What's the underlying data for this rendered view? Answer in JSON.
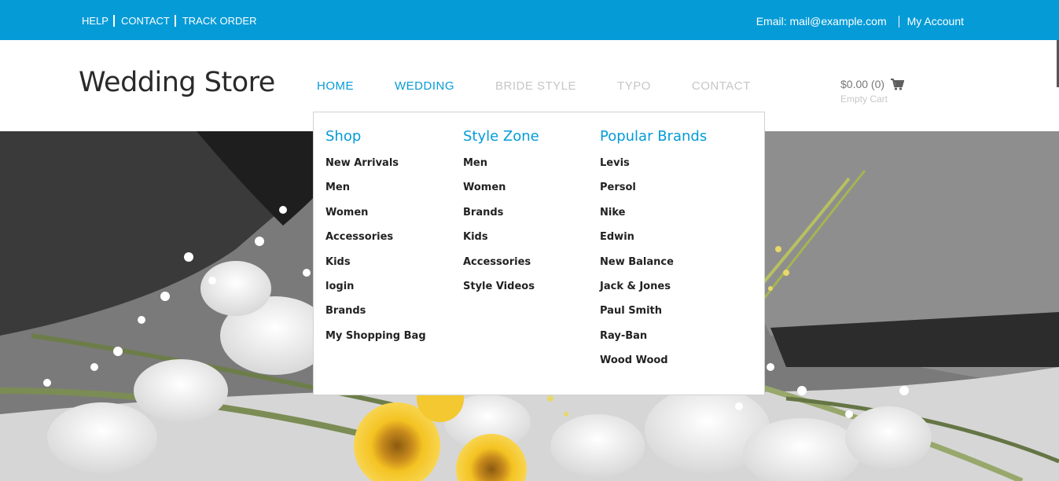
{
  "topbar": {
    "links": [
      "HELP",
      "CONTACT",
      "TRACK ORDER"
    ],
    "email": "Email: mail@example.com",
    "account": "My Account"
  },
  "header": {
    "logo": "Wedding Store",
    "nav": [
      "HOME",
      "WEDDING",
      "BRIDE STYLE",
      "TYPO",
      "CONTACT"
    ],
    "cart_amount": "$0.00 (0)",
    "cart_status": "Empty Cart"
  },
  "menu": {
    "columns": [
      {
        "title": "Shop",
        "items": [
          "New Arrivals",
          "Men",
          "Women",
          "Accessories",
          "Kids",
          "login",
          "Brands",
          "My Shopping Bag"
        ]
      },
      {
        "title": "Style Zone",
        "items": [
          "Men",
          "Women",
          "Brands",
          "Kids",
          "Accessories",
          "Style Videos"
        ]
      },
      {
        "title": "Popular Brands",
        "items": [
          "Levis",
          "Persol",
          "Nike",
          "Edwin",
          "New Balance",
          "Jack & Jones",
          "Paul Smith",
          "Ray-Ban",
          "Wood Wood"
        ]
      }
    ]
  },
  "colors": {
    "accent": "#049bd7",
    "nav_inactive": "#c6c6c6"
  },
  "icons": {
    "cart": "shopping-cart-icon"
  }
}
